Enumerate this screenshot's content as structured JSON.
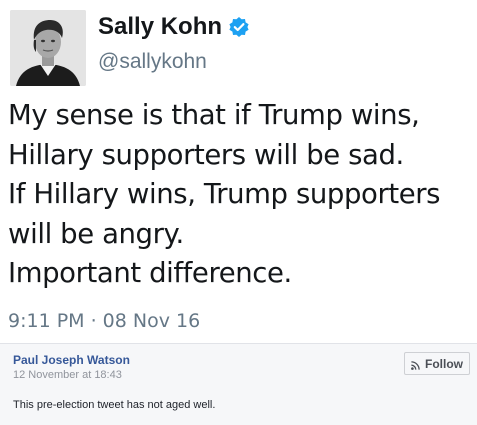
{
  "tweet": {
    "author_name": "Sally Kohn",
    "handle": "@sallykohn",
    "verified_icon": "verified-badge-icon",
    "lines": [
      "My sense is that if Trump wins,",
      "Hillary supporters will be sad.",
      "If Hillary wins, Trump supporters",
      "will be angry.",
      "Important difference."
    ],
    "timestamp": "9:11 PM · 08 Nov 16"
  },
  "post": {
    "poster_name": "Paul Joseph Watson",
    "date": "12 November at 18:43",
    "follow_label": "Follow",
    "follow_icon": "rss-icon",
    "caption": "This pre-election tweet has not aged well."
  },
  "colors": {
    "verified": "#1da1f2",
    "link": "#365899",
    "muted": "#657786"
  }
}
